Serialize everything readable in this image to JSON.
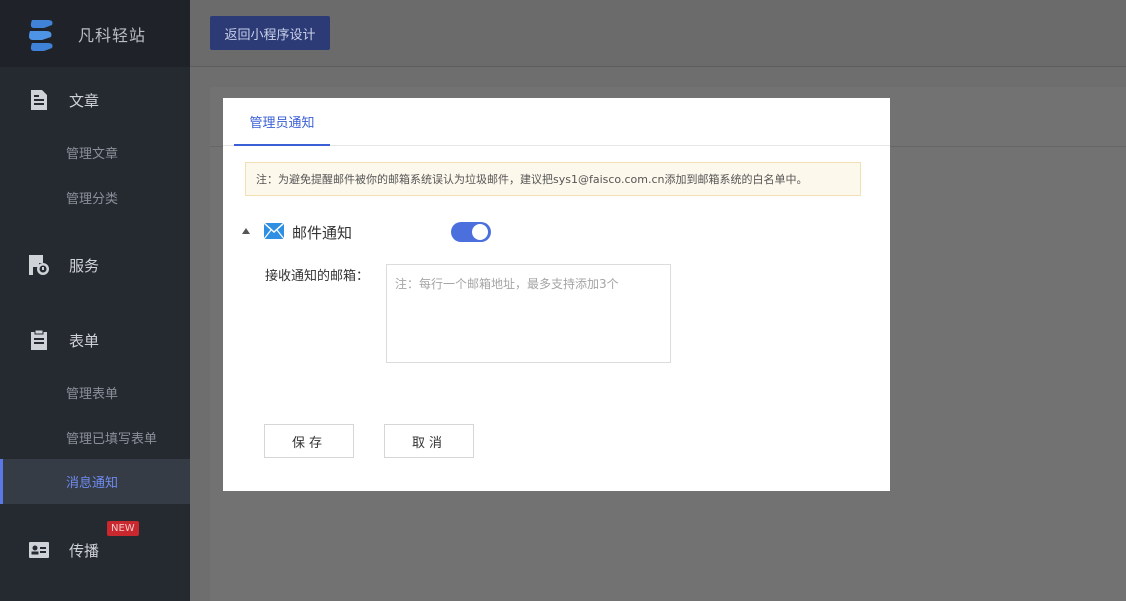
{
  "brand": {
    "name": "凡科轻站"
  },
  "sidebar": {
    "groups": [
      {
        "label": "文章",
        "icon": "document-icon"
      },
      {
        "label": "服务",
        "icon": "service-icon"
      },
      {
        "label": "表单",
        "icon": "clipboard-icon"
      },
      {
        "label": "传播",
        "icon": "id-card-icon"
      }
    ],
    "items": [
      {
        "label": "管理文章"
      },
      {
        "label": "管理分类"
      },
      {
        "label": "管理表单"
      },
      {
        "label": "管理已填写表单"
      },
      {
        "label": "消息通知",
        "active": true
      }
    ],
    "new_badge": "NEW"
  },
  "topbar": {
    "back_label": "返回小程序设计"
  },
  "modal": {
    "tab_label": "管理员通知",
    "notice": "注：为避免提醒邮件被你的邮箱系统误认为垃圾邮件，建议把sys1@faisco.com.cn添加到邮箱系统的白名单中。",
    "section_title": "邮件通知",
    "toggle_on": true,
    "field_label": "接收通知的邮箱：",
    "textarea_placeholder": "注：每行一个邮箱地址，最多支持添加3个",
    "save_label": "保存",
    "cancel_label": "取消"
  },
  "colors": {
    "accent": "#3a5fd6",
    "sidebar_bg": "#252a31",
    "active_item": "#6f8cf0",
    "badge": "#c8282e"
  }
}
